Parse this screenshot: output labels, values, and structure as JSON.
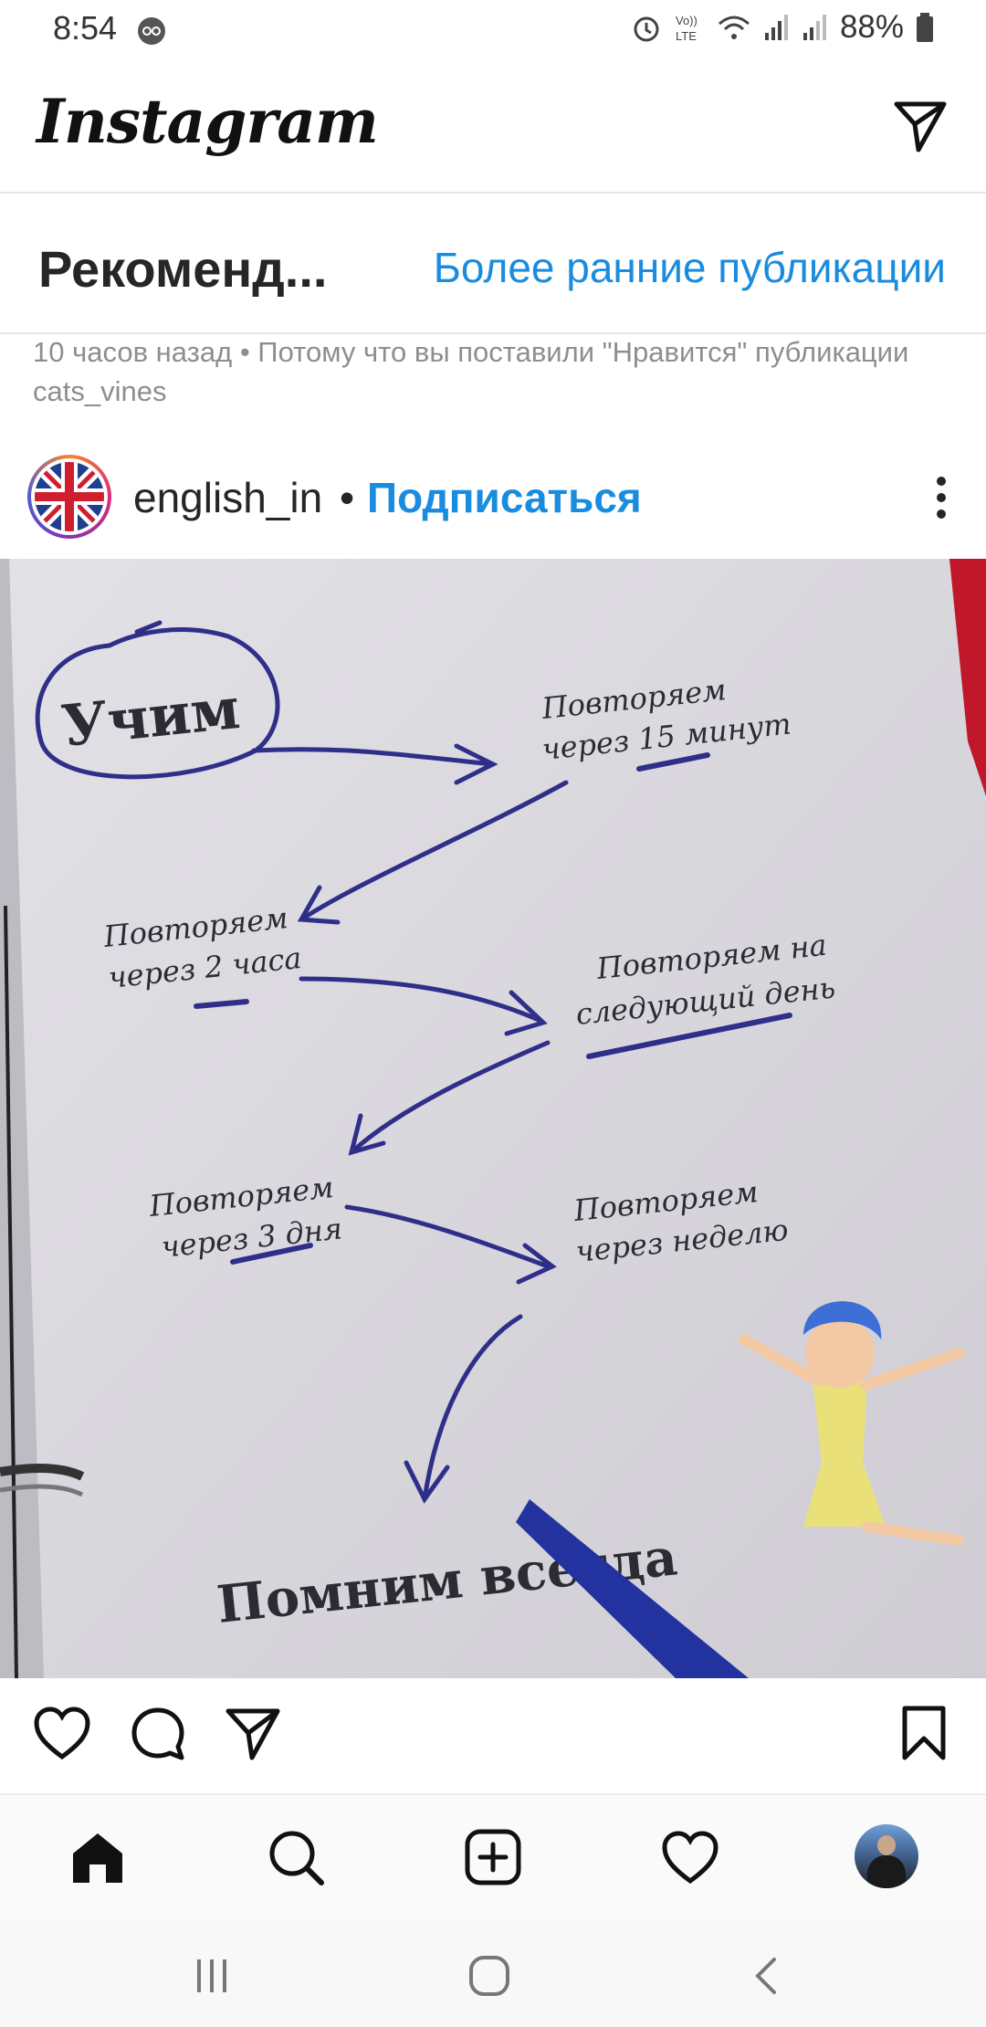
{
  "status_bar": {
    "time": "8:54",
    "battery": "88%"
  },
  "header": {
    "logo": "Instagram"
  },
  "recommended": {
    "title": "Рекоменд...",
    "earlier_link": "Более ранние публикации",
    "meta": "10 часов назад • Потому что вы поставили \"Нравится\" публикации cats_vines"
  },
  "post": {
    "username": "english_in",
    "separator": "•",
    "follow_label": "Подписаться",
    "image_text": {
      "learn": "Учим",
      "step1_a": "Повторяем",
      "step1_b": "через 15 минут",
      "step2_a": "Повторяем",
      "step2_b": "через 2 часа",
      "step3_a": "Повторяем на",
      "step3_b": "следующий день",
      "step4_a": "Повторяем",
      "step4_b": "через 3 дня",
      "step5_a": "Повторяем",
      "step5_b": "через неделю",
      "final": "Помним всегда"
    }
  },
  "icons": {
    "header_right": "direct-message-icon",
    "post_actions": [
      "heart-icon",
      "comment-icon",
      "share-icon",
      "bookmark-icon"
    ],
    "bottom_nav": [
      "home-icon",
      "search-icon",
      "add-post-icon",
      "activity-heart-icon",
      "profile-avatar"
    ],
    "system_nav": [
      "recents-icon",
      "home-circle-icon",
      "back-icon"
    ]
  },
  "colors": {
    "link_blue": "#1a8cdf",
    "text": "#262626",
    "meta_gray": "#8e8e8e",
    "ink_blue": "#2f2f8a"
  }
}
